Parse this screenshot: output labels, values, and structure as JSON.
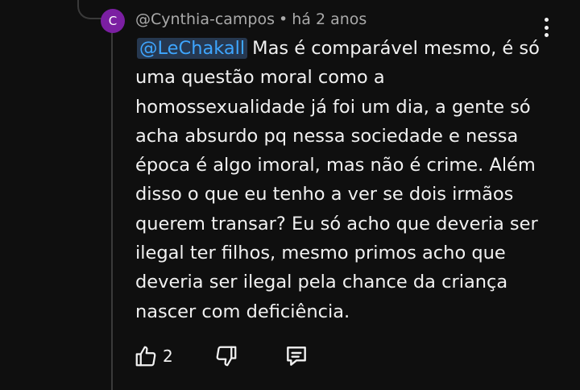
{
  "comment": {
    "avatar_letter": "C",
    "avatar_color": "#7b1fa2",
    "author": "@Cynthia-campos",
    "separator": "•",
    "time": "há 2 anos",
    "mention": "@LeChakall",
    "mention_color": "#3ea6ff",
    "lines": [
      "Mas é comparável mesmo, é só",
      "uma questão moral como a",
      "homossexualidade já foi um dia, a gente só",
      "acha absurdo pq nessa sociedade e nessa",
      "época é algo imoral, mas não é crime. Além",
      "disso o que eu tenho a ver se dois irmãos",
      "querem transar? Eu só acho que deveria ser",
      "ilegal ter filhos, mesmo primos acho que",
      "deveria ser ilegal pela chance da criança",
      "nascer com deficiência."
    ]
  },
  "actions": {
    "like_icon": "thumbs-up-icon",
    "like_count": "2",
    "dislike_icon": "thumbs-down-icon",
    "reply_icon": "reply-comment-icon"
  },
  "menu_icon": "more-vert-icon"
}
